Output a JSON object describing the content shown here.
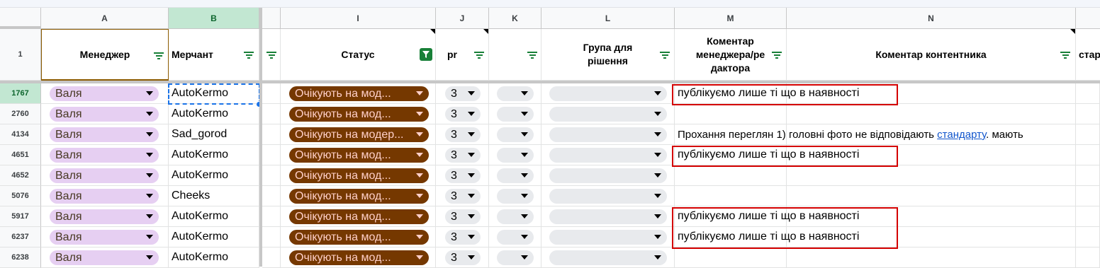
{
  "columns": {
    "A": "A",
    "B": "B",
    "I": "I",
    "J": "J",
    "K": "K",
    "L": "L",
    "M": "M",
    "N": "N"
  },
  "header_row_num": "1",
  "headers": {
    "manager": "Менеджер",
    "merchant": "Мерчант",
    "status": "Статус",
    "pr": "pr",
    "group_line1": "Група для",
    "group_line2": "рішення",
    "comment_line1": "Коментар",
    "comment_line2": "менеджера/ре",
    "comment_line3": "дактора",
    "content_comment": "Коментар контентника",
    "start_partial": "стар"
  },
  "rows": [
    {
      "num": "1767",
      "manager": "Валя",
      "merchant": "AutoKermo",
      "status": "Очікують на мод...",
      "pr": "3",
      "comment": "публікуємо лише ті що в наявності"
    },
    {
      "num": "2760",
      "manager": "Валя",
      "merchant": "AutoKermo",
      "status": "Очікують на мод...",
      "pr": "3",
      "comment": ""
    },
    {
      "num": "4134",
      "manager": "Валя",
      "merchant": "Sad_gorod",
      "status": "Очікують на модер...",
      "pr": "3",
      "comment": ""
    },
    {
      "num": "4651",
      "manager": "Валя",
      "merchant": "AutoKermo",
      "status": "Очікують на мод...",
      "pr": "3",
      "comment": "публікуємо лише ті що в наявності"
    },
    {
      "num": "4652",
      "manager": "Валя",
      "merchant": "AutoKermo",
      "status": "Очікують на мод...",
      "pr": "3",
      "comment": ""
    },
    {
      "num": "5076",
      "manager": "Валя",
      "merchant": "Cheeks",
      "status": "Очікують на мод...",
      "pr": "3",
      "comment": ""
    },
    {
      "num": "5917",
      "manager": "Валя",
      "merchant": "AutoKermo",
      "status": "Очікують на мод...",
      "pr": "3",
      "comment": "публікуємо лише ті що в наявності"
    },
    {
      "num": "6237",
      "manager": "Валя",
      "merchant": "AutoKermo",
      "status": "Очікують на мод...",
      "pr": "3",
      "comment": "публікуємо лише ті що в наявності"
    },
    {
      "num": "6238",
      "manager": "Валя",
      "merchant": "AutoKermo",
      "status": "Очікують на мод...",
      "pr": "3",
      "comment": ""
    }
  ],
  "overflow_text": {
    "before_link": "Прохання переглян 1) головні фото не відповідають ",
    "link": "стандарту",
    "after_link": ". мають"
  },
  "colors": {
    "manager_chip": "#e6cff2",
    "status_chip": "#753800",
    "selection": "#1a73e8",
    "highlight_box": "#d40000",
    "filter_active": "#188038"
  }
}
